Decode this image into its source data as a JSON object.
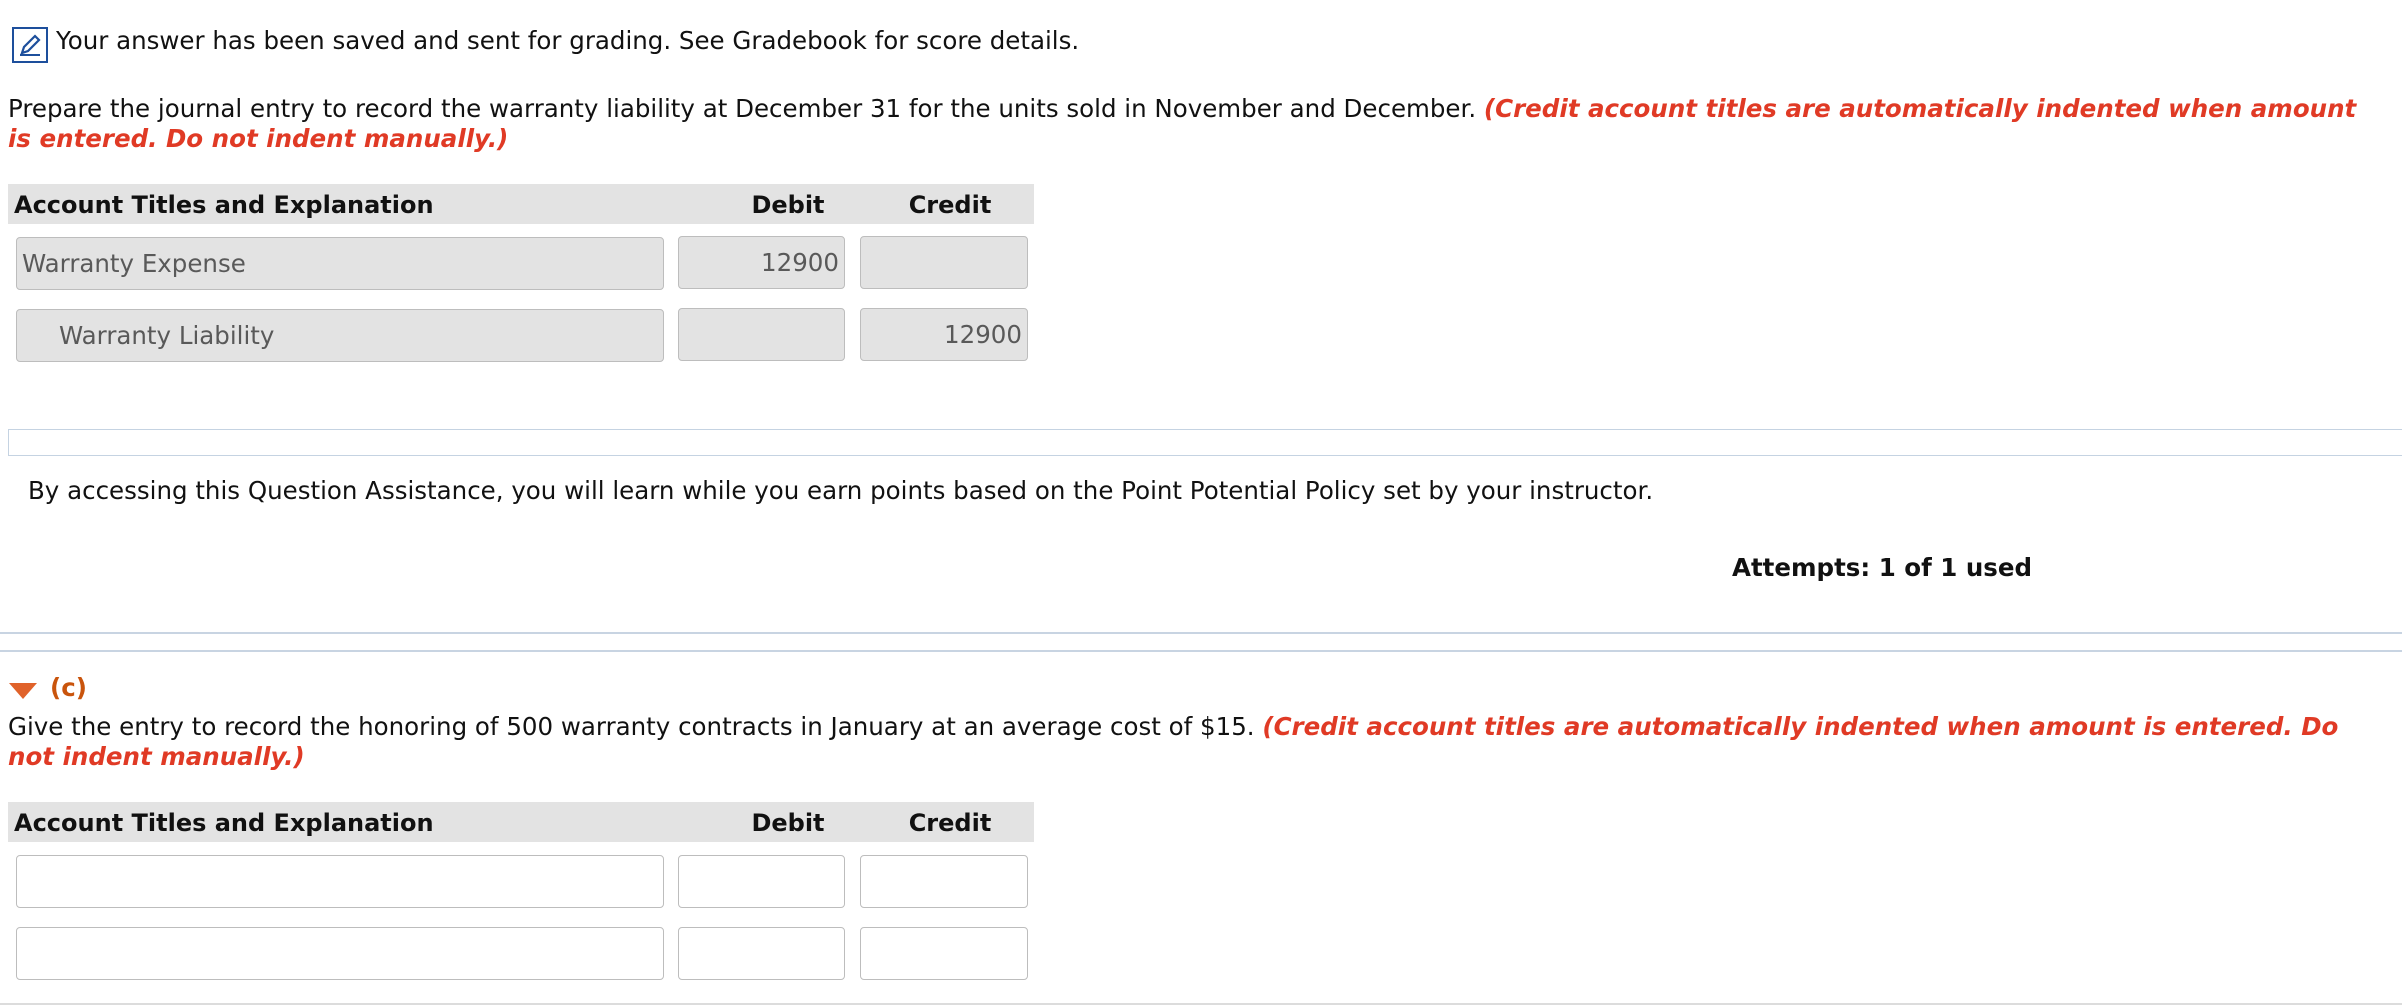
{
  "saved_notice": {
    "icon": "pencil-edit-icon",
    "text": "Your answer has been saved and sent for grading. See Gradebook for score details."
  },
  "part_b": {
    "instructions": "Prepare the journal entry to record the warranty liability at December 31 for the units sold in November and December.",
    "note": "(Credit account titles are automatically indented when amount is entered. Do not indent manually.)",
    "table": {
      "headers": {
        "account": "Account Titles and Explanation",
        "debit": "Debit",
        "credit": "Credit"
      },
      "rows": [
        {
          "account": "Warranty Expense",
          "debit": "12900",
          "credit": ""
        },
        {
          "account": "Warranty Liability",
          "debit": "",
          "credit": "12900"
        }
      ]
    }
  },
  "assistance": {
    "text": "By accessing this Question Assistance, you will learn while you earn points based on the Point Potential Policy set by your instructor.",
    "attempts": "Attempts: 1 of 1 used"
  },
  "part_c": {
    "label": "(c)",
    "toggle_icon": "triangle-down-icon",
    "instructions": "Give the entry to record the honoring of 500 warranty contracts in January at an average cost of $15.",
    "note": "(Credit account titles are automatically indented when amount is entered. Do not indent manually.)",
    "table": {
      "headers": {
        "account": "Account Titles and Explanation",
        "debit": "Debit",
        "credit": "Credit"
      },
      "rows": [
        {
          "account": "",
          "debit": "",
          "credit": ""
        },
        {
          "account": "",
          "debit": "",
          "credit": ""
        }
      ]
    }
  },
  "colors": {
    "accent_red": "#e03a25",
    "part_orange": "#c9540c",
    "icon_blue": "#1d4f9c",
    "header_gray": "#e3e3e3"
  }
}
